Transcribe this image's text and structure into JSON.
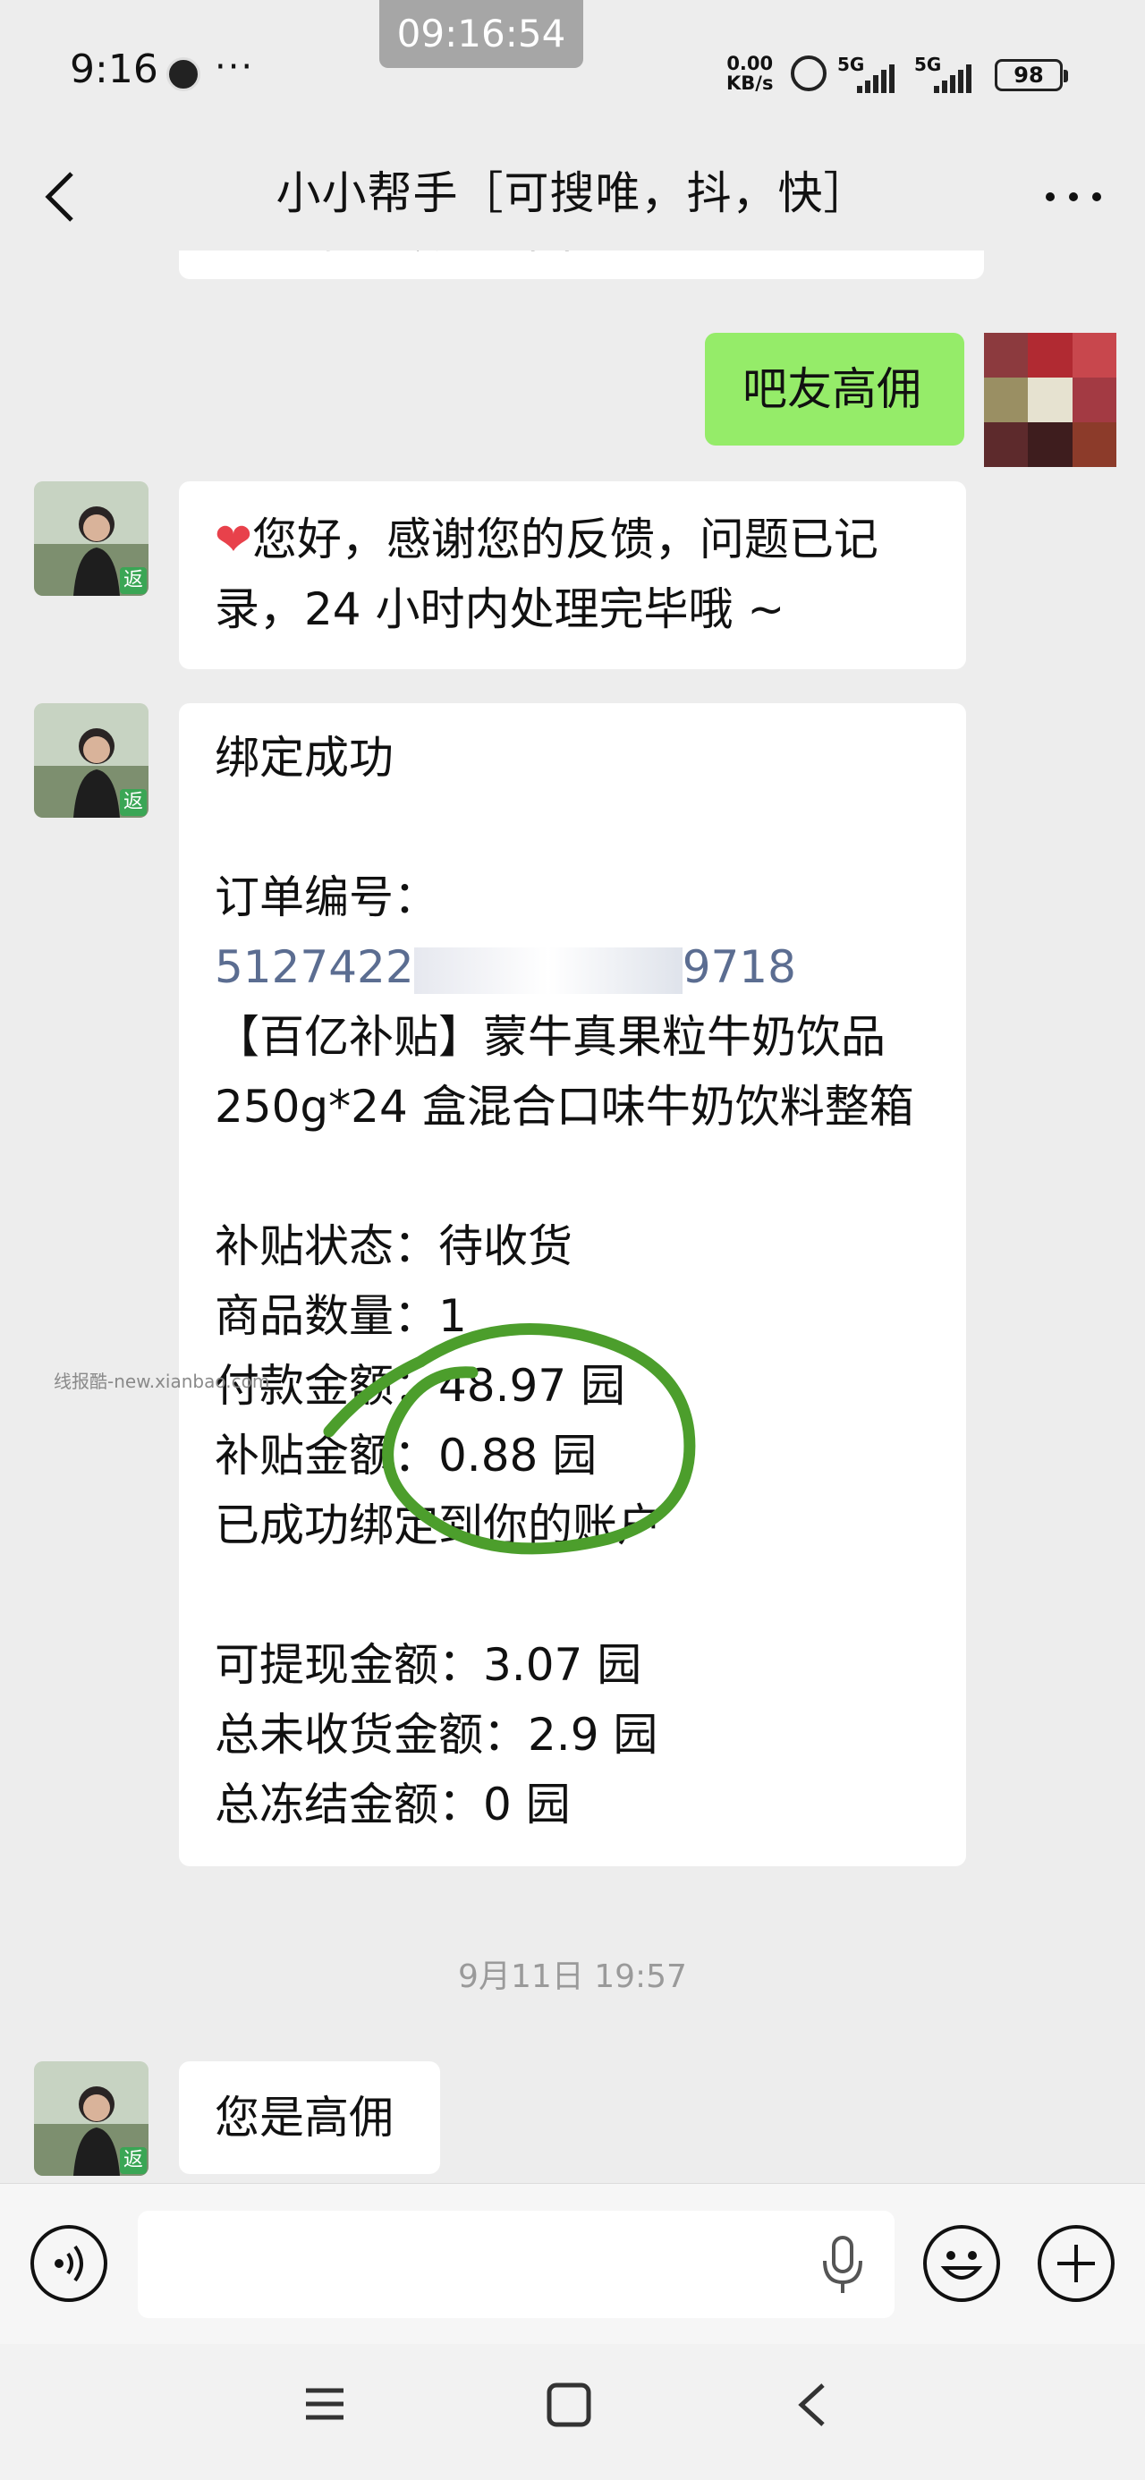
{
  "status_bar": {
    "time": "9:16",
    "more": "···",
    "network_speed": "0.00",
    "network_unit": "KB/s",
    "sim1": "5G",
    "sim2": "5G",
    "battery": "98"
  },
  "screenshot_timestamp": "09:16:54",
  "header": {
    "title": "小小帮手［可搜唯，抖，快］"
  },
  "messages": {
    "m0_partial": "总冻结金额：0 园",
    "m1": "吧友高佣",
    "m2_line1": "您好，感谢您的反馈，问题已记",
    "m2_line2": "录，24 小时内处理完毕哦 ~",
    "m3": {
      "l1": "绑定成功",
      "l2": "订单编号：",
      "l3a": "5127422",
      "l3b": "9718",
      "l4": "【百亿补贴】蒙牛真果粒牛奶饮品",
      "l5": "250g*24 盒混合口味牛奶饮料整箱",
      "l6": "补贴状态：待收货",
      "l7": "商品数量：1",
      "l8": "付款金额：48.97 园",
      "l9": "补贴金额：0.88 园",
      "l10": "已成功绑定到你的账户",
      "l11": "可提现金额：3.07 园",
      "l12": "总未收货金额：2.9 园",
      "l13": "总冻结金额：0 园"
    },
    "time_divider": "9月11日 19:57",
    "m4": "您是高佣"
  },
  "avatar_badge": "返",
  "watermark": "线报酷-new.xianbao.com",
  "icons": [
    "back-icon",
    "more-icon",
    "voice-toggle-icon",
    "microphone-icon",
    "emoji-icon",
    "plus-icon",
    "menu-icon",
    "home-icon",
    "nav-back-icon"
  ],
  "colors": {
    "sent_bubble": "#95ec69",
    "received_bubble": "#ffffff",
    "background": "#ededed",
    "annotation": "#4c9e2c"
  }
}
